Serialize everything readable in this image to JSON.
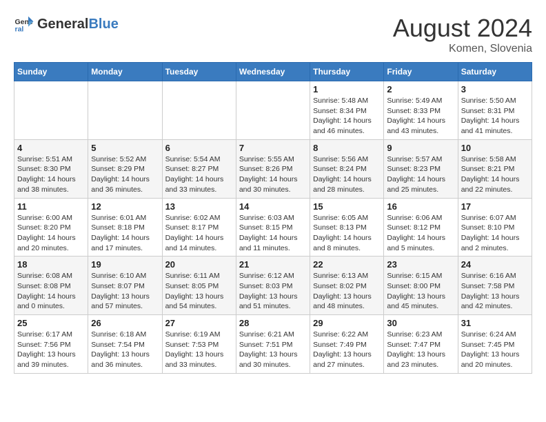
{
  "header": {
    "logo_general": "General",
    "logo_blue": "Blue",
    "month_year": "August 2024",
    "location": "Komen, Slovenia"
  },
  "weekdays": [
    "Sunday",
    "Monday",
    "Tuesday",
    "Wednesday",
    "Thursday",
    "Friday",
    "Saturday"
  ],
  "weeks": [
    [
      {
        "day": "",
        "info": ""
      },
      {
        "day": "",
        "info": ""
      },
      {
        "day": "",
        "info": ""
      },
      {
        "day": "",
        "info": ""
      },
      {
        "day": "1",
        "info": "Sunrise: 5:48 AM\nSunset: 8:34 PM\nDaylight: 14 hours and 46 minutes."
      },
      {
        "day": "2",
        "info": "Sunrise: 5:49 AM\nSunset: 8:33 PM\nDaylight: 14 hours and 43 minutes."
      },
      {
        "day": "3",
        "info": "Sunrise: 5:50 AM\nSunset: 8:31 PM\nDaylight: 14 hours and 41 minutes."
      }
    ],
    [
      {
        "day": "4",
        "info": "Sunrise: 5:51 AM\nSunset: 8:30 PM\nDaylight: 14 hours and 38 minutes."
      },
      {
        "day": "5",
        "info": "Sunrise: 5:52 AM\nSunset: 8:29 PM\nDaylight: 14 hours and 36 minutes."
      },
      {
        "day": "6",
        "info": "Sunrise: 5:54 AM\nSunset: 8:27 PM\nDaylight: 14 hours and 33 minutes."
      },
      {
        "day": "7",
        "info": "Sunrise: 5:55 AM\nSunset: 8:26 PM\nDaylight: 14 hours and 30 minutes."
      },
      {
        "day": "8",
        "info": "Sunrise: 5:56 AM\nSunset: 8:24 PM\nDaylight: 14 hours and 28 minutes."
      },
      {
        "day": "9",
        "info": "Sunrise: 5:57 AM\nSunset: 8:23 PM\nDaylight: 14 hours and 25 minutes."
      },
      {
        "day": "10",
        "info": "Sunrise: 5:58 AM\nSunset: 8:21 PM\nDaylight: 14 hours and 22 minutes."
      }
    ],
    [
      {
        "day": "11",
        "info": "Sunrise: 6:00 AM\nSunset: 8:20 PM\nDaylight: 14 hours and 20 minutes."
      },
      {
        "day": "12",
        "info": "Sunrise: 6:01 AM\nSunset: 8:18 PM\nDaylight: 14 hours and 17 minutes."
      },
      {
        "day": "13",
        "info": "Sunrise: 6:02 AM\nSunset: 8:17 PM\nDaylight: 14 hours and 14 minutes."
      },
      {
        "day": "14",
        "info": "Sunrise: 6:03 AM\nSunset: 8:15 PM\nDaylight: 14 hours and 11 minutes."
      },
      {
        "day": "15",
        "info": "Sunrise: 6:05 AM\nSunset: 8:13 PM\nDaylight: 14 hours and 8 minutes."
      },
      {
        "day": "16",
        "info": "Sunrise: 6:06 AM\nSunset: 8:12 PM\nDaylight: 14 hours and 5 minutes."
      },
      {
        "day": "17",
        "info": "Sunrise: 6:07 AM\nSunset: 8:10 PM\nDaylight: 14 hours and 2 minutes."
      }
    ],
    [
      {
        "day": "18",
        "info": "Sunrise: 6:08 AM\nSunset: 8:08 PM\nDaylight: 14 hours and 0 minutes."
      },
      {
        "day": "19",
        "info": "Sunrise: 6:10 AM\nSunset: 8:07 PM\nDaylight: 13 hours and 57 minutes."
      },
      {
        "day": "20",
        "info": "Sunrise: 6:11 AM\nSunset: 8:05 PM\nDaylight: 13 hours and 54 minutes."
      },
      {
        "day": "21",
        "info": "Sunrise: 6:12 AM\nSunset: 8:03 PM\nDaylight: 13 hours and 51 minutes."
      },
      {
        "day": "22",
        "info": "Sunrise: 6:13 AM\nSunset: 8:02 PM\nDaylight: 13 hours and 48 minutes."
      },
      {
        "day": "23",
        "info": "Sunrise: 6:15 AM\nSunset: 8:00 PM\nDaylight: 13 hours and 45 minutes."
      },
      {
        "day": "24",
        "info": "Sunrise: 6:16 AM\nSunset: 7:58 PM\nDaylight: 13 hours and 42 minutes."
      }
    ],
    [
      {
        "day": "25",
        "info": "Sunrise: 6:17 AM\nSunset: 7:56 PM\nDaylight: 13 hours and 39 minutes."
      },
      {
        "day": "26",
        "info": "Sunrise: 6:18 AM\nSunset: 7:54 PM\nDaylight: 13 hours and 36 minutes."
      },
      {
        "day": "27",
        "info": "Sunrise: 6:19 AM\nSunset: 7:53 PM\nDaylight: 13 hours and 33 minutes."
      },
      {
        "day": "28",
        "info": "Sunrise: 6:21 AM\nSunset: 7:51 PM\nDaylight: 13 hours and 30 minutes."
      },
      {
        "day": "29",
        "info": "Sunrise: 6:22 AM\nSunset: 7:49 PM\nDaylight: 13 hours and 27 minutes."
      },
      {
        "day": "30",
        "info": "Sunrise: 6:23 AM\nSunset: 7:47 PM\nDaylight: 13 hours and 23 minutes."
      },
      {
        "day": "31",
        "info": "Sunrise: 6:24 AM\nSunset: 7:45 PM\nDaylight: 13 hours and 20 minutes."
      }
    ]
  ]
}
